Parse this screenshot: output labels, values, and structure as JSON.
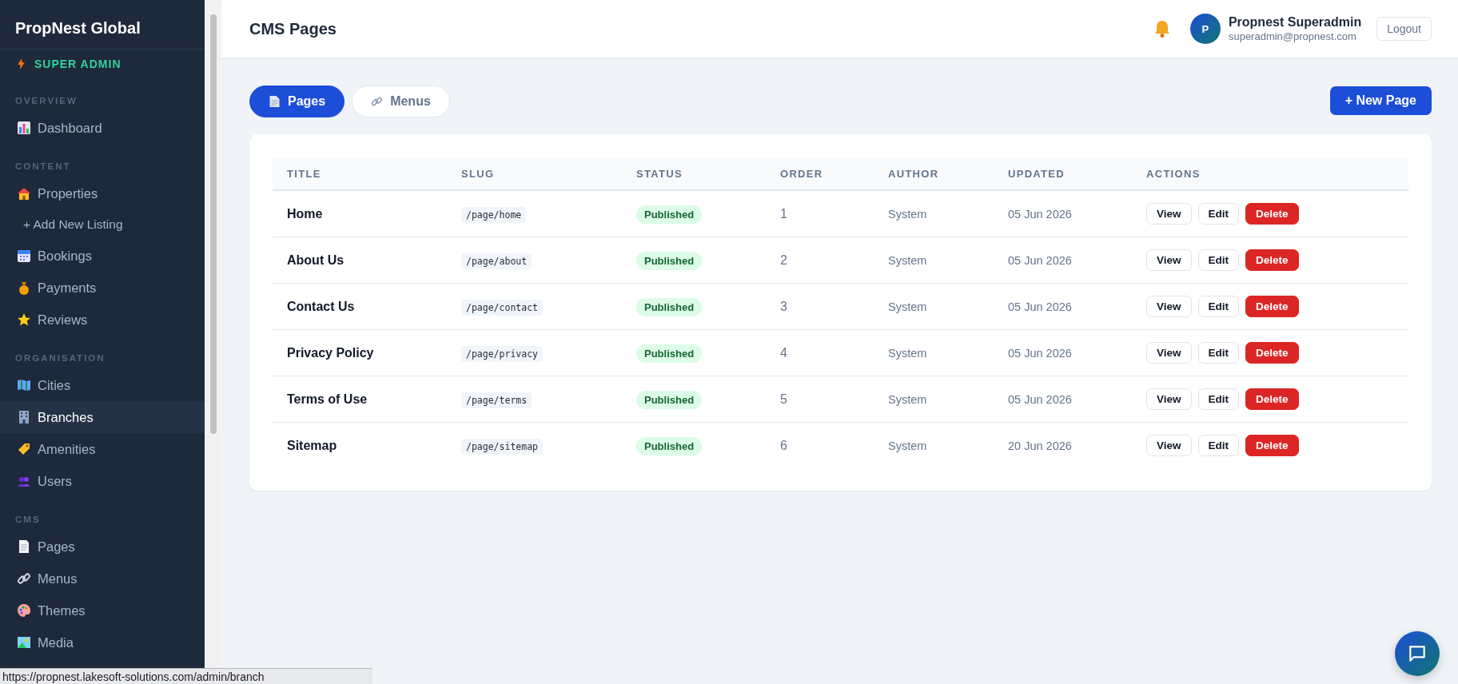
{
  "sidebar": {
    "brand": "PropNest Global",
    "role": "SUPER ADMIN",
    "sections": [
      {
        "heading": "OVERVIEW",
        "items": [
          {
            "label": "Dashboard",
            "kind": "link",
            "selected": false
          }
        ]
      },
      {
        "heading": "CONTENT",
        "items": [
          {
            "label": "Properties",
            "kind": "link",
            "selected": false
          },
          {
            "label": "+ Add New Listing",
            "kind": "sub",
            "selected": false
          },
          {
            "label": "Bookings",
            "kind": "link",
            "selected": false
          },
          {
            "label": "Payments",
            "kind": "link",
            "selected": false
          },
          {
            "label": "Reviews",
            "kind": "link",
            "selected": false
          }
        ]
      },
      {
        "heading": "ORGANISATION",
        "items": [
          {
            "label": "Cities",
            "kind": "link",
            "selected": false
          },
          {
            "label": "Branches",
            "kind": "link",
            "selected": true
          },
          {
            "label": "Amenities",
            "kind": "link",
            "selected": false
          },
          {
            "label": "Users",
            "kind": "link",
            "selected": false
          }
        ]
      },
      {
        "heading": "CMS",
        "items": [
          {
            "label": "Pages",
            "kind": "link",
            "selected": false
          },
          {
            "label": "Menus",
            "kind": "link",
            "selected": false
          },
          {
            "label": "Themes",
            "kind": "link",
            "selected": false
          },
          {
            "label": "Media",
            "kind": "link",
            "selected": false
          }
        ]
      }
    ]
  },
  "header": {
    "title": "CMS Pages",
    "user": {
      "initial": "P",
      "name": "Propnest Superadmin",
      "email": "superadmin@propnest.com"
    },
    "logout": "Logout"
  },
  "tabs": [
    {
      "label": "Pages",
      "selected": true
    },
    {
      "label": "Menus",
      "selected": false
    }
  ],
  "new_button": "+ New Page",
  "table": {
    "columns": [
      "TITLE",
      "SLUG",
      "STATUS",
      "ORDER",
      "AUTHOR",
      "UPDATED",
      "ACTIONS"
    ],
    "rows": [
      {
        "title": "Home",
        "slug": "/page/home",
        "status": "Published",
        "order": "1",
        "author": "System",
        "updated": "05 Jun 2026",
        "actions": [
          {
            "label": "View",
            "kind": "plain"
          },
          {
            "label": "Edit",
            "kind": "plain"
          },
          {
            "label": "Delete",
            "kind": "danger"
          }
        ]
      },
      {
        "title": "About Us",
        "slug": "/page/about",
        "status": "Published",
        "order": "2",
        "author": "System",
        "updated": "05 Jun 2026",
        "actions": [
          {
            "label": "View",
            "kind": "plain"
          },
          {
            "label": "Edit",
            "kind": "plain"
          },
          {
            "label": "Delete",
            "kind": "danger"
          }
        ]
      },
      {
        "title": "Contact Us",
        "slug": "/page/contact",
        "status": "Published",
        "order": "3",
        "author": "System",
        "updated": "05 Jun 2026",
        "actions": [
          {
            "label": "View",
            "kind": "plain"
          },
          {
            "label": "Edit",
            "kind": "plain"
          },
          {
            "label": "Delete",
            "kind": "danger"
          }
        ]
      },
      {
        "title": "Privacy Policy",
        "slug": "/page/privacy",
        "status": "Published",
        "order": "4",
        "author": "System",
        "updated": "05 Jun 2026",
        "actions": [
          {
            "label": "View",
            "kind": "plain"
          },
          {
            "label": "Edit",
            "kind": "plain"
          },
          {
            "label": "Delete",
            "kind": "danger"
          }
        ]
      },
      {
        "title": "Terms of Use",
        "slug": "/page/terms",
        "status": "Published",
        "order": "5",
        "author": "System",
        "updated": "05 Jun 2026",
        "actions": [
          {
            "label": "View",
            "kind": "plain"
          },
          {
            "label": "Edit",
            "kind": "plain"
          },
          {
            "label": "Delete",
            "kind": "danger"
          }
        ]
      },
      {
        "title": "Sitemap",
        "slug": "/page/sitemap",
        "status": "Published",
        "order": "6",
        "author": "System",
        "updated": "20 Jun 2026",
        "actions": [
          {
            "label": "View",
            "kind": "plain"
          },
          {
            "label": "Edit",
            "kind": "plain"
          },
          {
            "label": "Delete",
            "kind": "danger"
          }
        ]
      }
    ]
  },
  "status_bar": "https://propnest.lakesoft-solutions.com/admin/branch"
}
